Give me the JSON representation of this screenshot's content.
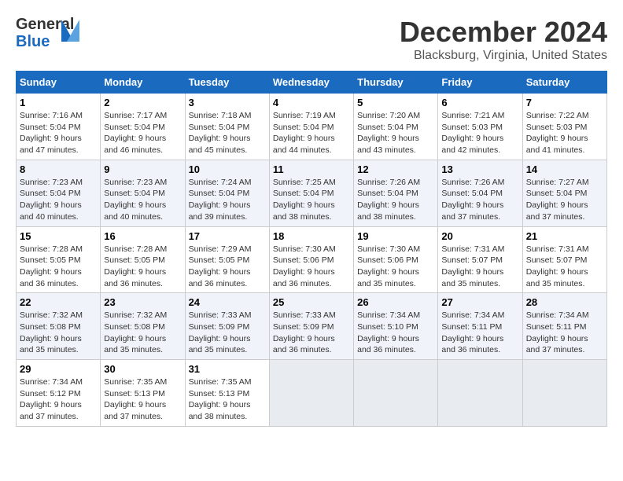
{
  "header": {
    "logo_general": "General",
    "logo_blue": "Blue",
    "month_title": "December 2024",
    "location": "Blacksburg, Virginia, United States"
  },
  "weekdays": [
    "Sunday",
    "Monday",
    "Tuesday",
    "Wednesday",
    "Thursday",
    "Friday",
    "Saturday"
  ],
  "weeks": [
    [
      {
        "day": "1",
        "sunrise": "7:16 AM",
        "sunset": "5:04 PM",
        "daylight": "9 hours and 47 minutes."
      },
      {
        "day": "2",
        "sunrise": "7:17 AM",
        "sunset": "5:04 PM",
        "daylight": "9 hours and 46 minutes."
      },
      {
        "day": "3",
        "sunrise": "7:18 AM",
        "sunset": "5:04 PM",
        "daylight": "9 hours and 45 minutes."
      },
      {
        "day": "4",
        "sunrise": "7:19 AM",
        "sunset": "5:04 PM",
        "daylight": "9 hours and 44 minutes."
      },
      {
        "day": "5",
        "sunrise": "7:20 AM",
        "sunset": "5:04 PM",
        "daylight": "9 hours and 43 minutes."
      },
      {
        "day": "6",
        "sunrise": "7:21 AM",
        "sunset": "5:03 PM",
        "daylight": "9 hours and 42 minutes."
      },
      {
        "day": "7",
        "sunrise": "7:22 AM",
        "sunset": "5:03 PM",
        "daylight": "9 hours and 41 minutes."
      }
    ],
    [
      {
        "day": "8",
        "sunrise": "7:23 AM",
        "sunset": "5:04 PM",
        "daylight": "9 hours and 40 minutes."
      },
      {
        "day": "9",
        "sunrise": "7:23 AM",
        "sunset": "5:04 PM",
        "daylight": "9 hours and 40 minutes."
      },
      {
        "day": "10",
        "sunrise": "7:24 AM",
        "sunset": "5:04 PM",
        "daylight": "9 hours and 39 minutes."
      },
      {
        "day": "11",
        "sunrise": "7:25 AM",
        "sunset": "5:04 PM",
        "daylight": "9 hours and 38 minutes."
      },
      {
        "day": "12",
        "sunrise": "7:26 AM",
        "sunset": "5:04 PM",
        "daylight": "9 hours and 38 minutes."
      },
      {
        "day": "13",
        "sunrise": "7:26 AM",
        "sunset": "5:04 PM",
        "daylight": "9 hours and 37 minutes."
      },
      {
        "day": "14",
        "sunrise": "7:27 AM",
        "sunset": "5:04 PM",
        "daylight": "9 hours and 37 minutes."
      }
    ],
    [
      {
        "day": "15",
        "sunrise": "7:28 AM",
        "sunset": "5:05 PM",
        "daylight": "9 hours and 36 minutes."
      },
      {
        "day": "16",
        "sunrise": "7:28 AM",
        "sunset": "5:05 PM",
        "daylight": "9 hours and 36 minutes."
      },
      {
        "day": "17",
        "sunrise": "7:29 AM",
        "sunset": "5:05 PM",
        "daylight": "9 hours and 36 minutes."
      },
      {
        "day": "18",
        "sunrise": "7:30 AM",
        "sunset": "5:06 PM",
        "daylight": "9 hours and 36 minutes."
      },
      {
        "day": "19",
        "sunrise": "7:30 AM",
        "sunset": "5:06 PM",
        "daylight": "9 hours and 35 minutes."
      },
      {
        "day": "20",
        "sunrise": "7:31 AM",
        "sunset": "5:07 PM",
        "daylight": "9 hours and 35 minutes."
      },
      {
        "day": "21",
        "sunrise": "7:31 AM",
        "sunset": "5:07 PM",
        "daylight": "9 hours and 35 minutes."
      }
    ],
    [
      {
        "day": "22",
        "sunrise": "7:32 AM",
        "sunset": "5:08 PM",
        "daylight": "9 hours and 35 minutes."
      },
      {
        "day": "23",
        "sunrise": "7:32 AM",
        "sunset": "5:08 PM",
        "daylight": "9 hours and 35 minutes."
      },
      {
        "day": "24",
        "sunrise": "7:33 AM",
        "sunset": "5:09 PM",
        "daylight": "9 hours and 35 minutes."
      },
      {
        "day": "25",
        "sunrise": "7:33 AM",
        "sunset": "5:09 PM",
        "daylight": "9 hours and 36 minutes."
      },
      {
        "day": "26",
        "sunrise": "7:34 AM",
        "sunset": "5:10 PM",
        "daylight": "9 hours and 36 minutes."
      },
      {
        "day": "27",
        "sunrise": "7:34 AM",
        "sunset": "5:11 PM",
        "daylight": "9 hours and 36 minutes."
      },
      {
        "day": "28",
        "sunrise": "7:34 AM",
        "sunset": "5:11 PM",
        "daylight": "9 hours and 37 minutes."
      }
    ],
    [
      {
        "day": "29",
        "sunrise": "7:34 AM",
        "sunset": "5:12 PM",
        "daylight": "9 hours and 37 minutes."
      },
      {
        "day": "30",
        "sunrise": "7:35 AM",
        "sunset": "5:13 PM",
        "daylight": "9 hours and 37 minutes."
      },
      {
        "day": "31",
        "sunrise": "7:35 AM",
        "sunset": "5:13 PM",
        "daylight": "9 hours and 38 minutes."
      },
      null,
      null,
      null,
      null
    ]
  ],
  "labels": {
    "sunrise": "Sunrise:",
    "sunset": "Sunset:",
    "daylight": "Daylight:"
  }
}
